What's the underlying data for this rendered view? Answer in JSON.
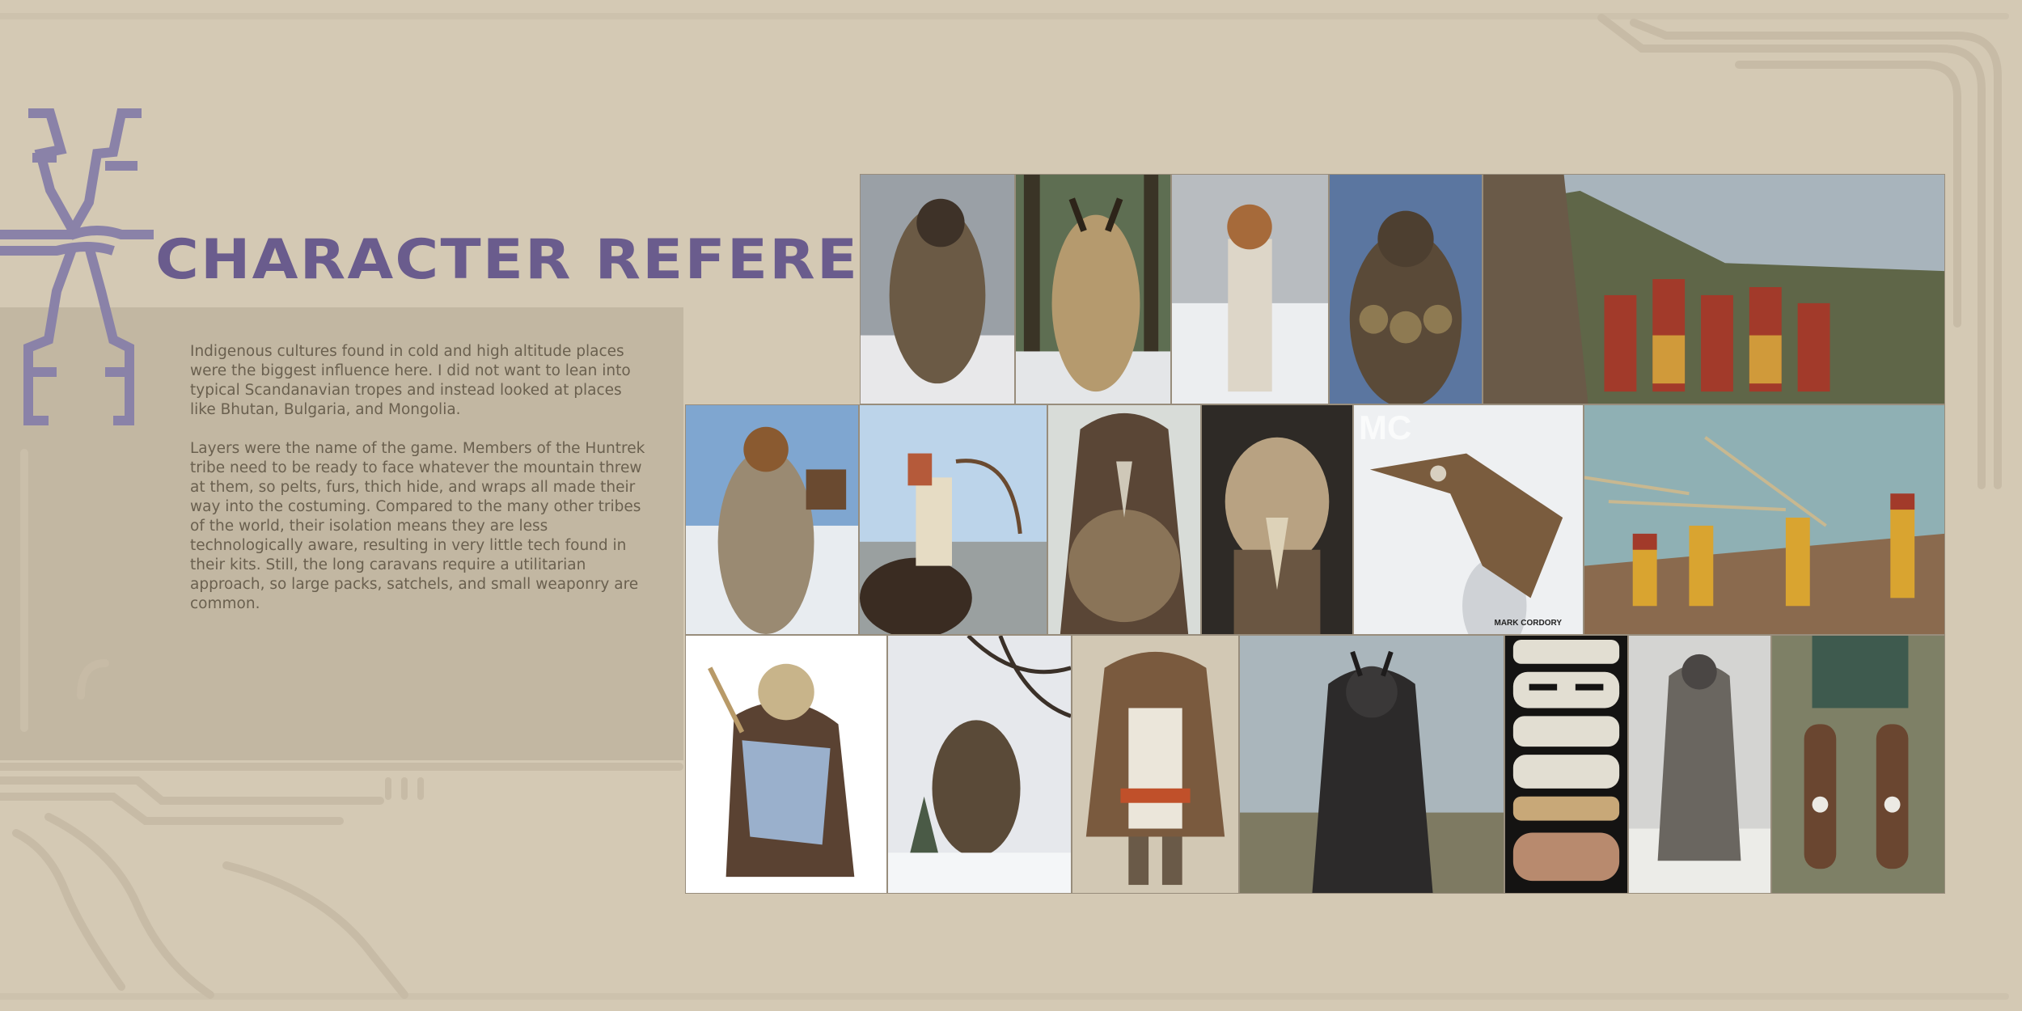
{
  "page": {
    "title": "CHARACTER REFERENCE",
    "paragraphs": [
      "Indigenous cultures found in cold and high altitude places were the biggest influence here. I did not want to lean into typical Scandanavian tropes and instead looked at places like Bhutan, Bulgaria, and Mongolia.",
      "Layers were the name of the game. Members of the Huntrek tribe need to be ready to face whatever the mountain threw at them, so pelts, furs, thich hide, and wraps all made their way into the costuming. Compared to the many other tribes of the world, their isolation means they are less technologically aware, resulting in very little tech found in their kits. Still, the long caravans require a utilitarian approach, so large packs, satchels, and small weaponry are common."
    ],
    "photo_credits": {
      "mask_credit": "MARK CORDORY",
      "photo_watermark": "MC"
    }
  },
  "colors": {
    "background": "#d4c9b4",
    "band": "#c2b7a2",
    "title": "#6a5c8d",
    "emblem": "#8a82a8",
    "text": "#6a604f",
    "ornament": "#c8bca7"
  }
}
